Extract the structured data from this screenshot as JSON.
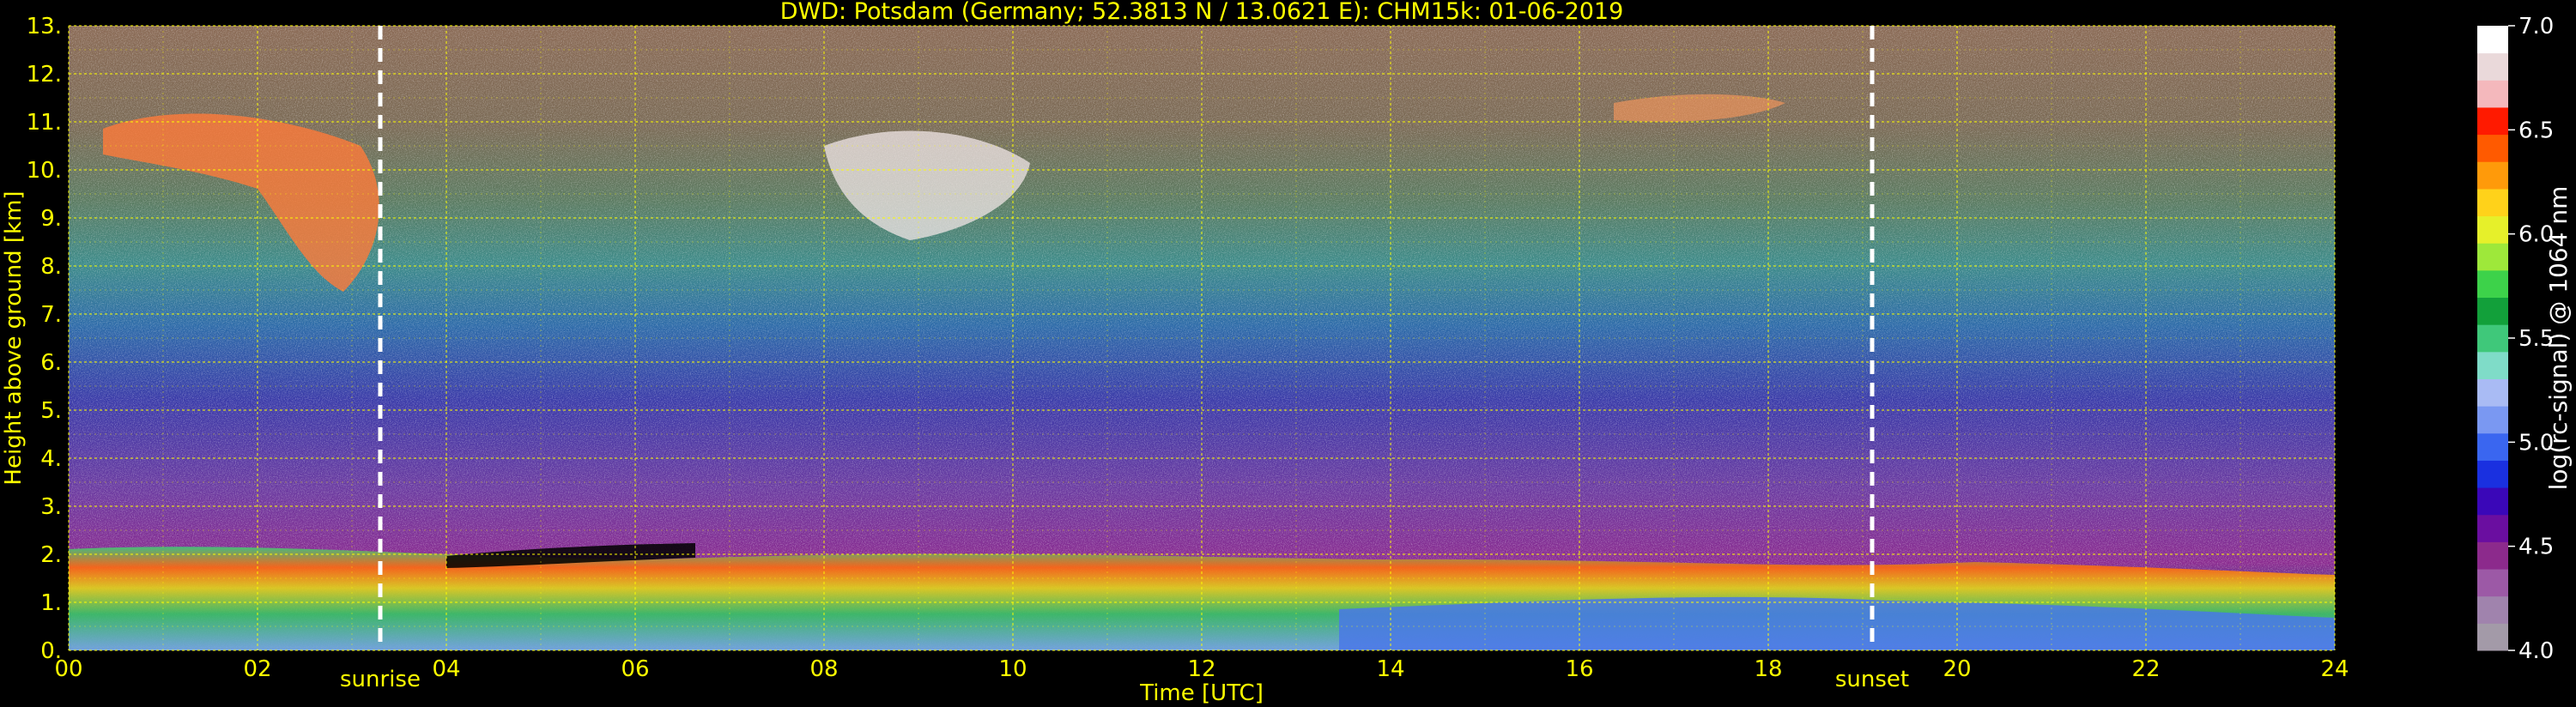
{
  "chart_data": {
    "type": "heatmap",
    "title": "DWD: Potsdam (Germany; 52.3813 N / 13.0621 E):    CHM15k: 01-06-2019",
    "xlabel": "Time [UTC]",
    "ylabel": "Height above ground [km]",
    "xlim": [
      0,
      24
    ],
    "ylim": [
      0,
      13
    ],
    "x_ticks": [
      "00",
      "02",
      "04",
      "06",
      "08",
      "10",
      "12",
      "14",
      "16",
      "18",
      "20",
      "22",
      "24"
    ],
    "y_ticks": [
      "0.",
      "1.",
      "2.",
      "3.",
      "4.",
      "5.",
      "6.",
      "7.",
      "8.",
      "9.",
      "10.",
      "11.",
      "12.",
      "13."
    ],
    "grid": true,
    "event_markers": [
      {
        "label": "sunrise",
        "x": 3.3
      },
      {
        "label": "sunset",
        "x": 19.1
      }
    ],
    "colorbar": {
      "label": "log(rc-signal) @ 1064 nm",
      "range": [
        4.0,
        7.0
      ],
      "ticks": [
        "4.0",
        "4.5",
        "5.0",
        "5.5",
        "6.0",
        "6.5",
        "7.0"
      ],
      "colors": [
        "#a39aa8",
        "#a083ad",
        "#9c59a6",
        "#8c2a8c",
        "#6a0ea0",
        "#3a07b8",
        "#1a30e0",
        "#3a66f0",
        "#7a98f2",
        "#a9bbf4",
        "#7fdcc8",
        "#3fc87a",
        "#12a03a",
        "#3dd24a",
        "#9ee83a",
        "#e6f02a",
        "#ffd21a",
        "#ff9a0a",
        "#ff5a00",
        "#ff1a00",
        "#f4b8bc",
        "#ead9da",
        "#ffffff"
      ]
    }
  }
}
